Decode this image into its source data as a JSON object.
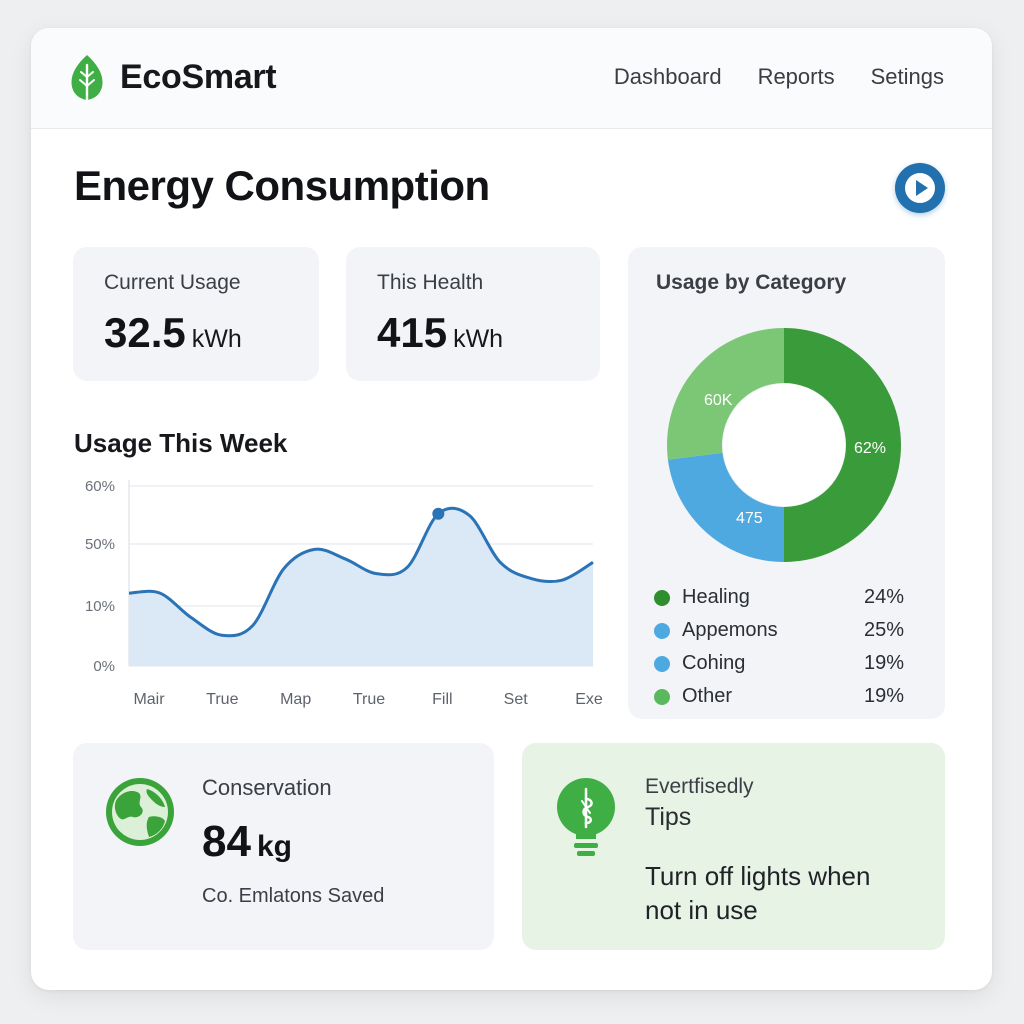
{
  "app": {
    "brand": "EcoSmart"
  },
  "nav": {
    "items": [
      "Dashboard",
      "Reports",
      "Setings"
    ]
  },
  "page": {
    "title": "Energy Consumption"
  },
  "stats": [
    {
      "label": "Current Usage",
      "value": "32.5",
      "unit": "kWh"
    },
    {
      "label": "This Health",
      "value": "415",
      "unit": "kWh"
    }
  ],
  "week_chart": {
    "title": "Usage This Week"
  },
  "chart_data": [
    {
      "type": "area",
      "title": "Usage This Week",
      "x": [
        "Mair",
        "True",
        "Map",
        "True",
        "Fill",
        "Set",
        "Exe"
      ],
      "y_ticks": [
        "0%",
        "10%",
        "50%",
        "60%"
      ],
      "series": [
        {
          "values": [
            0.45,
            0.45,
            0.3,
            0.19,
            0.25,
            0.6,
            0.72,
            0.66,
            0.57,
            0.61,
            0.94,
            0.93,
            0.64,
            0.54,
            0.53,
            0.64
          ]
        }
      ],
      "grid": true,
      "color": "#2a73b6",
      "fill": "#dbe8f6"
    },
    {
      "type": "pie",
      "title": "Usage by Category",
      "slice_labels": [
        "62%",
        "475",
        "60K"
      ],
      "slice_shares": [
        0.5,
        0.23,
        0.27
      ],
      "slice_colors": [
        "#3a9b3a",
        "#4ea9e0",
        "#7cc775"
      ],
      "legend_placement": "bottom"
    }
  ],
  "category": {
    "title": "Usage by Category",
    "legend": [
      {
        "name": "Healing",
        "pct": "24%",
        "color": "#2f8f2f"
      },
      {
        "name": "Appemons",
        "pct": "25%",
        "color": "#4ea9e0"
      },
      {
        "name": "Cohing",
        "pct": "19%",
        "color": "#4ea9e0"
      },
      {
        "name": "Other",
        "pct": "19%",
        "color": "#5cb85c"
      }
    ]
  },
  "conservation": {
    "label": "Conservation",
    "value": "84",
    "unit": "kg",
    "sub": "Co. Emlatons Saved"
  },
  "tips": {
    "eyebrow": "Evertfisedly",
    "title": "Tips",
    "text": "Turn off lights when not in use"
  },
  "colors": {
    "accent_green": "#3aa33a",
    "accent_blue": "#2270ad",
    "card_bg": "#f2f4f8",
    "tip_bg": "#e6f3e5"
  },
  "icons": {
    "logo": "leaf-icon",
    "play": "play-icon",
    "globe": "globe-icon",
    "bulb": "lightbulb-icon"
  }
}
